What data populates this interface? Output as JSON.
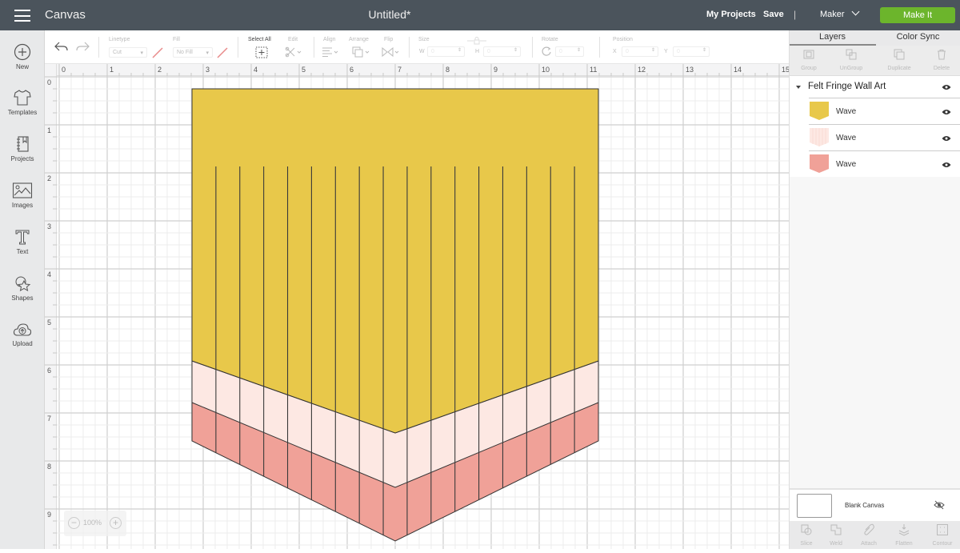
{
  "topbar": {
    "app_title": "Canvas",
    "doc_title": "Untitled*",
    "my_projects": "My Projects",
    "save": "Save",
    "separator": "|",
    "machine": "Maker",
    "make_it": "Make It",
    "make_it_color": "#6cb52c"
  },
  "leftnav": {
    "items": [
      {
        "label": "New",
        "icon": "plus-circle-icon"
      },
      {
        "label": "Templates",
        "icon": "tshirt-icon"
      },
      {
        "label": "Projects",
        "icon": "notebook-icon"
      },
      {
        "label": "Images",
        "icon": "image-icon"
      },
      {
        "label": "Text",
        "icon": "text-icon"
      },
      {
        "label": "Shapes",
        "icon": "shapes-icon"
      },
      {
        "label": "Upload",
        "icon": "cloud-upload-icon"
      }
    ]
  },
  "toolbar": {
    "linetype_label": "Linetype",
    "linetype_value": "Cut",
    "fill_label": "Fill",
    "fill_value": "No Fill",
    "select_all": "Select All",
    "edit": "Edit",
    "align": "Align",
    "arrange": "Arrange",
    "flip": "Flip",
    "size": "Size",
    "w_label": "W",
    "w_value": "0",
    "h_label": "H",
    "h_value": "0",
    "rotate": "Rotate",
    "rotate_value": "0",
    "position": "Position",
    "x_label": "X",
    "x_value": "0",
    "y_label": "Y",
    "y_value": "0"
  },
  "ruler": {
    "horizontal": [
      "0",
      "1",
      "2",
      "3",
      "4",
      "5",
      "6",
      "7",
      "8",
      "9",
      "10",
      "11",
      "12",
      "13",
      "14",
      "15"
    ],
    "vertical": [
      "0",
      "1",
      "2",
      "3",
      "4",
      "5",
      "6",
      "7",
      "8",
      "9"
    ]
  },
  "zoom": {
    "value": "100%",
    "minus": "−",
    "plus": "+"
  },
  "design": {
    "colors": {
      "yellow": "#e8c84a",
      "light_pink": "#fde8e3",
      "salmon": "#f0a198",
      "stroke": "#333333"
    },
    "fringe_count": 16
  },
  "rightpanel": {
    "tabs": [
      "Layers",
      "Color Sync"
    ],
    "actions": [
      "Group",
      "UnGroup",
      "Duplicate",
      "Delete"
    ],
    "group_name": "Felt Fringe Wall Art",
    "layers": [
      {
        "name": "Wave",
        "color": "#e8c84a"
      },
      {
        "name": "Wave",
        "color": "#fde8e3"
      },
      {
        "name": "Wave",
        "color": "#f0a198"
      }
    ],
    "blank_canvas": "Blank Canvas",
    "bottom_actions": [
      "Slice",
      "Weld",
      "Attach",
      "Flatten",
      "Contour"
    ]
  }
}
